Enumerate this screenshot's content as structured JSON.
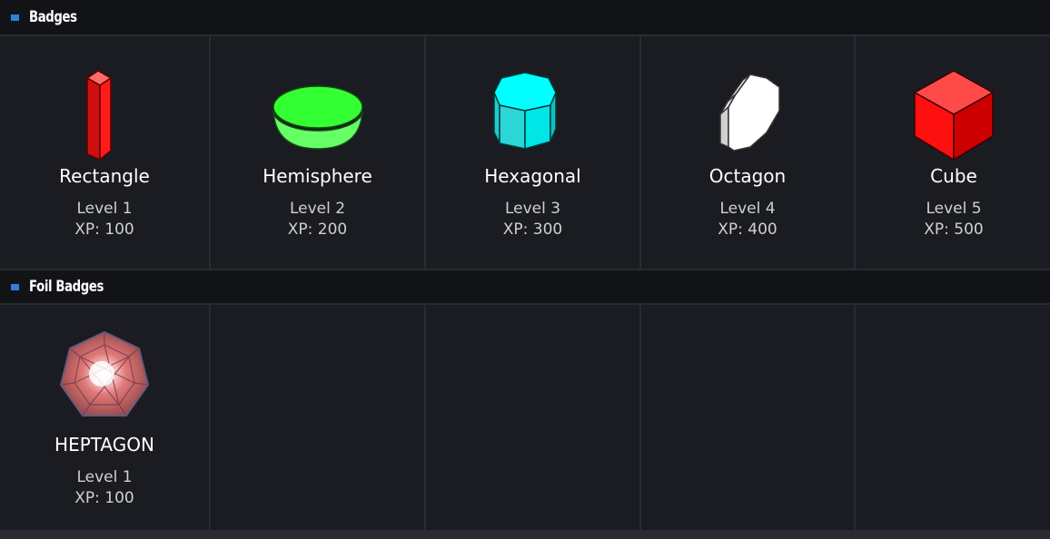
{
  "sections": {
    "badges": {
      "title": "Badges",
      "items": [
        {
          "name": "Rectangle",
          "level": "Level 1",
          "xp": "XP: 100",
          "icon": "rectangle-prism-icon",
          "color": "#ff1a1a"
        },
        {
          "name": "Hemisphere",
          "level": "Level 2",
          "xp": "XP: 200",
          "icon": "hemisphere-icon",
          "color": "#33ff33"
        },
        {
          "name": "Hexagonal",
          "level": "Level 3",
          "xp": "XP: 300",
          "icon": "hexagonal-prism-icon",
          "color": "#00ffff"
        },
        {
          "name": "Octagon",
          "level": "Level 4",
          "xp": "XP: 400",
          "icon": "octagon-prism-icon",
          "color": "#ffffff"
        },
        {
          "name": "Cube",
          "level": "Level 5",
          "xp": "XP: 500",
          "icon": "cube-icon",
          "color": "#ff2a2a"
        }
      ]
    },
    "foil_badges": {
      "title": "Foil Badges",
      "items": [
        {
          "name": "HEPTAGON",
          "level": "Level 1",
          "xp": "XP: 100",
          "icon": "foil-heptagon-icon",
          "color": "#d96a6a"
        }
      ]
    }
  },
  "colors": {
    "accent": "#2f7fe0",
    "background": "#1b1c21",
    "header_background": "#121317"
  }
}
